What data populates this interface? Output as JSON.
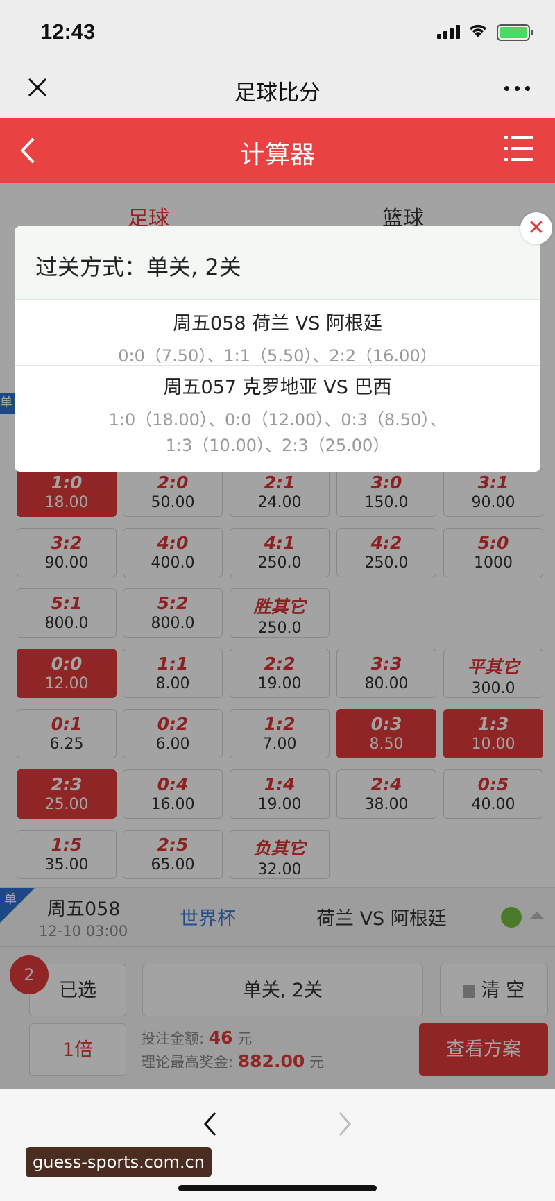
{
  "status": {
    "time": "12:43"
  },
  "wx_header": {
    "title": "足球比分"
  },
  "red_header": {
    "title": "计算器"
  },
  "tabs": {
    "football": "足球",
    "basketball": "篮球"
  },
  "side_tag": "单",
  "score_cells": [
    {
      "score": "1:0",
      "odds": "18.00",
      "selected": true
    },
    {
      "score": "2:0",
      "odds": "50.00",
      "selected": false
    },
    {
      "score": "2:1",
      "odds": "24.00",
      "selected": false
    },
    {
      "score": "3:0",
      "odds": "150.0",
      "selected": false
    },
    {
      "score": "3:1",
      "odds": "90.00",
      "selected": false
    },
    {
      "score": "3:2",
      "odds": "90.00",
      "selected": false
    },
    {
      "score": "4:0",
      "odds": "400.0",
      "selected": false
    },
    {
      "score": "4:1",
      "odds": "250.0",
      "selected": false
    },
    {
      "score": "4:2",
      "odds": "250.0",
      "selected": false
    },
    {
      "score": "5:0",
      "odds": "1000",
      "selected": false
    },
    {
      "score": "5:1",
      "odds": "800.0",
      "selected": false
    },
    {
      "score": "5:2",
      "odds": "800.0",
      "selected": false
    },
    {
      "score": "胜其它",
      "odds": "250.0",
      "selected": false
    },
    {
      "score": "0:0",
      "odds": "12.00",
      "selected": true
    },
    {
      "score": "1:1",
      "odds": "8.00",
      "selected": false
    },
    {
      "score": "2:2",
      "odds": "19.00",
      "selected": false
    },
    {
      "score": "3:3",
      "odds": "80.00",
      "selected": false
    },
    {
      "score": "平其它",
      "odds": "300.0",
      "selected": false
    },
    {
      "score": "0:1",
      "odds": "6.25",
      "selected": false
    },
    {
      "score": "0:2",
      "odds": "6.00",
      "selected": false
    },
    {
      "score": "1:2",
      "odds": "7.00",
      "selected": false
    },
    {
      "score": "0:3",
      "odds": "8.50",
      "selected": true
    },
    {
      "score": "1:3",
      "odds": "10.00",
      "selected": true
    },
    {
      "score": "2:3",
      "odds": "25.00",
      "selected": true
    },
    {
      "score": "0:4",
      "odds": "16.00",
      "selected": false
    },
    {
      "score": "1:4",
      "odds": "19.00",
      "selected": false
    },
    {
      "score": "2:4",
      "odds": "38.00",
      "selected": false
    },
    {
      "score": "0:5",
      "odds": "40.00",
      "selected": false
    },
    {
      "score": "1:5",
      "odds": "35.00",
      "selected": false
    },
    {
      "score": "2:5",
      "odds": "65.00",
      "selected": false
    },
    {
      "score": "负其它",
      "odds": "32.00",
      "selected": false
    }
  ],
  "match_row": {
    "flag": "单",
    "date": "周五058",
    "time": "12-10 03:00",
    "league": "世界杯",
    "teams": "荷兰 VS 阿根廷"
  },
  "bottom_bar": {
    "count": "2",
    "selected_label": "已选",
    "mode": "单关, 2关",
    "clear": "清 空",
    "multiplier": "1倍",
    "bet_label": "投注金额:",
    "bet_value": "46",
    "bet_unit": "元",
    "max_label": "理论最高奖金:",
    "max_value": "882.00",
    "max_unit": "元",
    "submit": "查看方案"
  },
  "popup": {
    "title": "过关方式：单关, 2关",
    "matches": [
      {
        "title": "周五058 荷兰 VS 阿根廷",
        "odds": [
          "0:0（7.50）、1:1（5.50）、2:2（16.00）"
        ]
      },
      {
        "title": "周五057 克罗地亚 VS 巴西",
        "odds": [
          "1:0（18.00）、0:0（12.00）、0:3（8.50）、",
          "1:3（10.00）、2:3（25.00）"
        ]
      }
    ],
    "close": "✕"
  },
  "watermark": "guess-sports.com.cn"
}
